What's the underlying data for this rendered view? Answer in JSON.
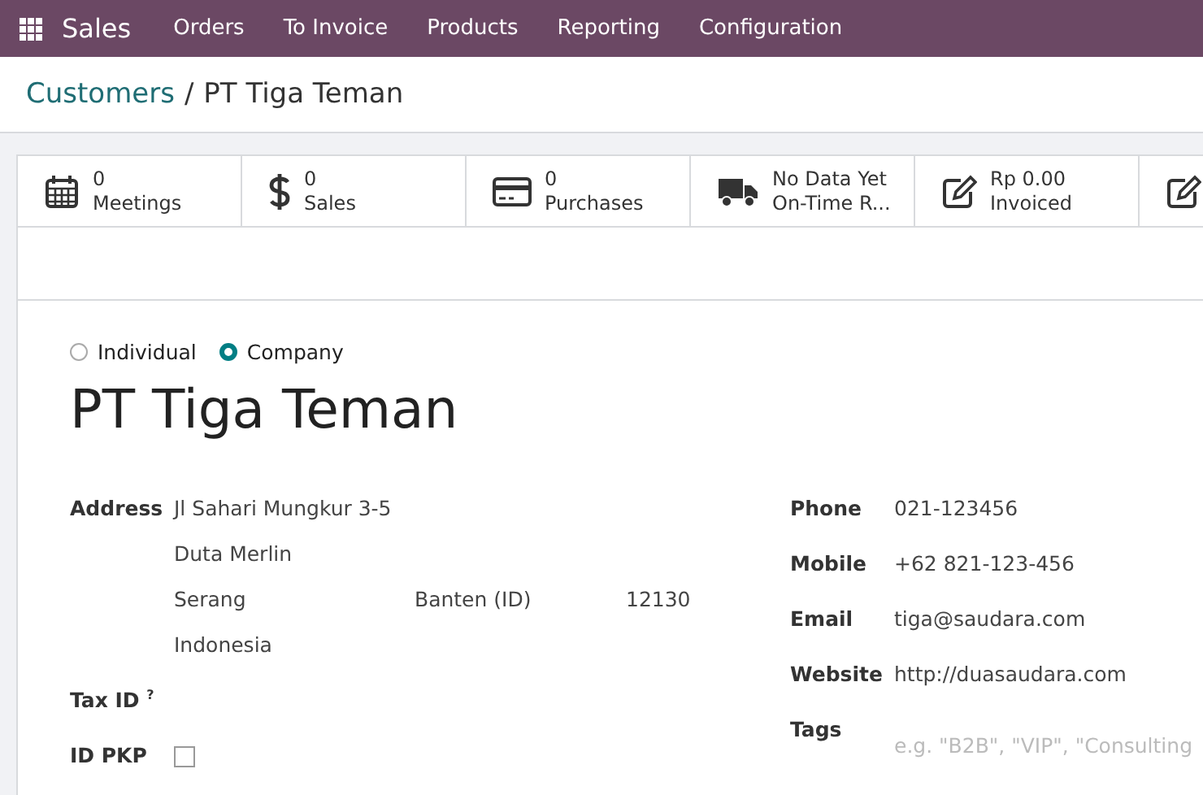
{
  "navbar": {
    "app": "Sales",
    "menu": [
      "Orders",
      "To Invoice",
      "Products",
      "Reporting",
      "Configuration"
    ]
  },
  "breadcrumb": {
    "parent": "Customers",
    "separator": "/",
    "current": "PT Tiga Teman"
  },
  "stat_buttons": [
    {
      "kind": "calendar",
      "value": "0",
      "label": "Meetings"
    },
    {
      "kind": "dollar",
      "value": "0",
      "label": "Sales"
    },
    {
      "kind": "card",
      "value": "0",
      "label": "Purchases"
    },
    {
      "kind": "truck",
      "value": "No Data Yet",
      "label": "On-Time R..."
    },
    {
      "kind": "edit",
      "value": "Rp 0.00",
      "label": "Invoiced"
    },
    {
      "kind": "edit"
    }
  ],
  "company_type": [
    {
      "label": "Individual",
      "selected": false
    },
    {
      "label": "Company",
      "selected": true
    }
  ],
  "name": "PT Tiga Teman",
  "address": {
    "label": "Address",
    "street": "Jl Sahari Mungkur 3-5",
    "street2": "Duta Merlin",
    "city": "Serang",
    "state": "Banten (ID)",
    "zip": "12130",
    "country": "Indonesia"
  },
  "tax_id": {
    "label": "Tax ID",
    "help": "?"
  },
  "id_pkp": {
    "label": "ID PKP",
    "checked": false
  },
  "contact": [
    {
      "label": "Phone",
      "value": "021-123456"
    },
    {
      "label": "Mobile",
      "value": "+62 821-123-456"
    },
    {
      "label": "Email",
      "value": "tiga@saudara.com"
    },
    {
      "label": "Website",
      "value": "http://duasaudara.com"
    },
    {
      "label": "Tags",
      "placeholder": "e.g. \"B2B\", \"VIP\", \"Consulting"
    }
  ]
}
